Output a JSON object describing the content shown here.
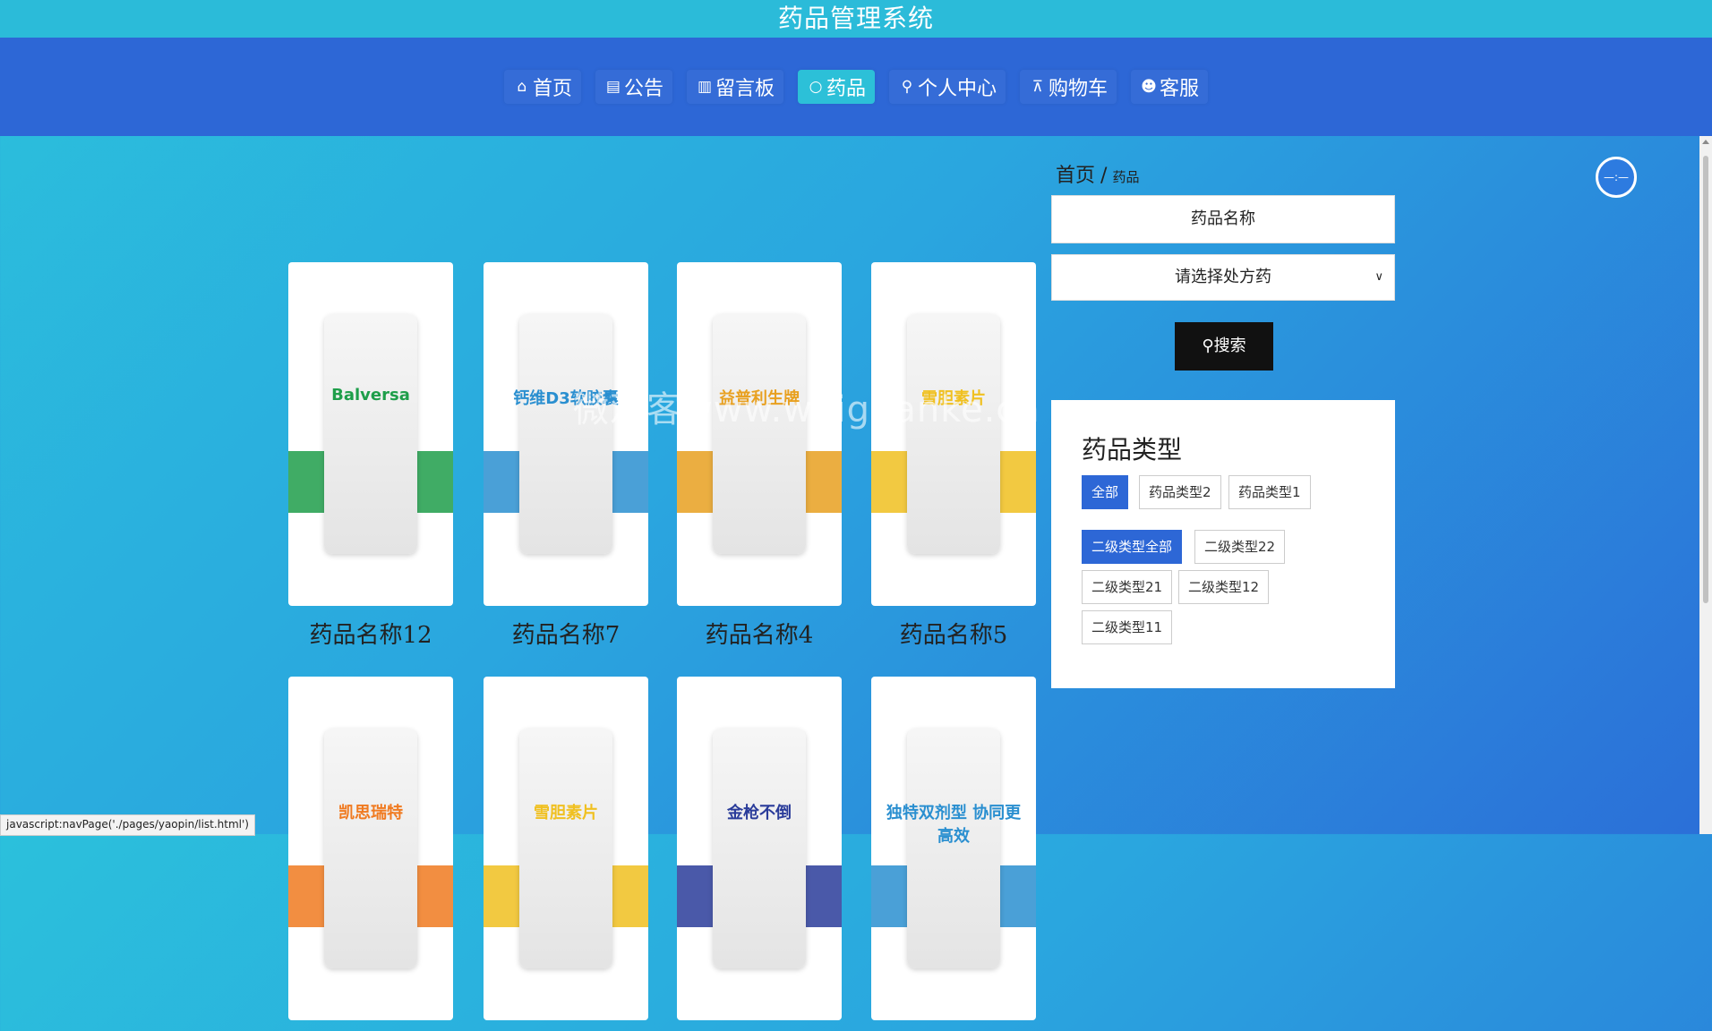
{
  "header": {
    "title": "药品管理系统"
  },
  "nav": [
    {
      "label": "首页",
      "icon": "home-icon",
      "glyph": "⌂",
      "active": false
    },
    {
      "label": "公告",
      "icon": "notice-icon",
      "glyph": "▤",
      "active": false
    },
    {
      "label": "留言板",
      "icon": "message-board-icon",
      "glyph": "▥",
      "active": false
    },
    {
      "label": "药品",
      "icon": "medicine-icon",
      "glyph": "○",
      "active": true
    },
    {
      "label": "个人中心",
      "icon": "user-icon",
      "glyph": "⚲",
      "active": false
    },
    {
      "label": "购物车",
      "icon": "cart-icon",
      "glyph": "⊼",
      "active": false
    },
    {
      "label": "客服",
      "icon": "service-icon",
      "glyph": "☻",
      "active": false
    }
  ],
  "breadcrumb": {
    "home": "首页",
    "separator": "/",
    "current": "药品"
  },
  "search": {
    "placeholder": "药品名称",
    "select_value": "请选择处方药",
    "button": "搜索"
  },
  "categories": {
    "title": "药品类型",
    "level1": [
      {
        "label": "全部",
        "active": true
      },
      {
        "label": "药品类型2",
        "active": false
      },
      {
        "label": "药品类型1",
        "active": false
      }
    ],
    "level2": [
      {
        "label": "二级类型全部",
        "active": true
      },
      {
        "label": "二级类型22",
        "active": false
      },
      {
        "label": "二级类型21",
        "active": false
      },
      {
        "label": "二级类型12",
        "active": false
      },
      {
        "label": "二级类型11",
        "active": false
      }
    ]
  },
  "products": [
    {
      "name": "药品名称12",
      "img_text": "Balversa",
      "accent": "#1e9e4a"
    },
    {
      "name": "药品名称7",
      "img_text": "钙维D3软胶囊",
      "accent": "#2a8fd0"
    },
    {
      "name": "药品名称4",
      "img_text": "益普利生牌",
      "accent": "#e8a020"
    },
    {
      "name": "药品名称5",
      "img_text": "雪胆素片",
      "accent": "#f0c020"
    },
    {
      "name": "",
      "img_text": "凯思瑞特",
      "accent": "#f07a20"
    },
    {
      "name": "",
      "img_text": "雪胆素片",
      "accent": "#f0c020"
    },
    {
      "name": "",
      "img_text": "金枪不倒",
      "accent": "#2a3c9a"
    },
    {
      "name": "",
      "img_text": "独特双剂型 协同更高效",
      "accent": "#2a8fd0"
    }
  ],
  "watermark": "微观客www.weiguanke.cn",
  "statusbar": "javascript:navPage('./pages/yaopin/list.html')",
  "float_button": "—:—"
}
